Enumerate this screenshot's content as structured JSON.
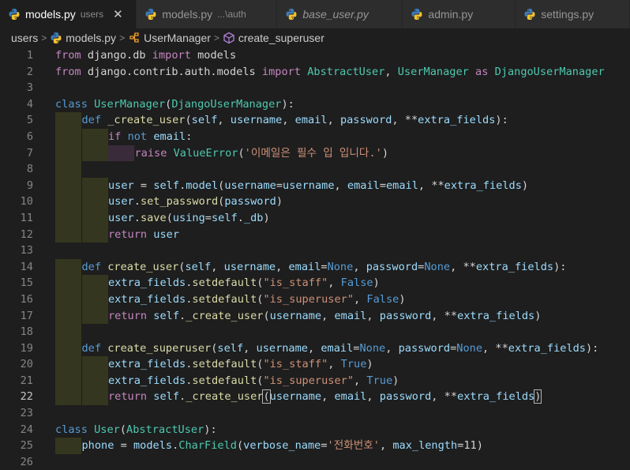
{
  "tabs": [
    {
      "name": "models.py",
      "desc": "users",
      "active": true
    },
    {
      "name": "models.py",
      "desc": "...\\auth",
      "active": false
    },
    {
      "name": "base_user.py",
      "desc": "",
      "active": false,
      "italic": true
    },
    {
      "name": "admin.py",
      "desc": "",
      "active": false
    },
    {
      "name": "settings.py",
      "desc": "",
      "active": false
    }
  ],
  "close_glyph": "✕",
  "breadcrumb": {
    "folder": "users",
    "file": "models.py",
    "class": "UserManager",
    "method": "create_superuser"
  },
  "editor": {
    "current_line": 22,
    "lines": [
      {
        "n": "1",
        "indent": 0,
        "tokens": [
          [
            "from",
            "k"
          ],
          [
            " django.db ",
            "p"
          ],
          [
            "import",
            "k"
          ],
          [
            " models",
            "p"
          ]
        ]
      },
      {
        "n": "2",
        "indent": 0,
        "tokens": [
          [
            "from",
            "k"
          ],
          [
            " django.contrib.auth.models ",
            "p"
          ],
          [
            "import",
            "k"
          ],
          [
            " ",
            "p"
          ],
          [
            "AbstractUser",
            "c"
          ],
          [
            ", ",
            "p"
          ],
          [
            "UserManager",
            "c"
          ],
          [
            " ",
            "p"
          ],
          [
            "as",
            "k"
          ],
          [
            " ",
            "p"
          ],
          [
            "DjangoUserManager",
            "c"
          ]
        ]
      },
      {
        "n": "3",
        "indent": 0,
        "tokens": []
      },
      {
        "n": "4",
        "indent": 0,
        "tokens": [
          [
            "class",
            "b"
          ],
          [
            " ",
            "p"
          ],
          [
            "UserManager",
            "c"
          ],
          [
            "(",
            "p"
          ],
          [
            "DjangoUserManager",
            "c"
          ],
          [
            "):",
            "p"
          ]
        ]
      },
      {
        "n": "5",
        "indent": 1,
        "tokens": [
          [
            "def",
            "b"
          ],
          [
            " ",
            "p"
          ],
          [
            "_create_user",
            "f"
          ],
          [
            "(",
            "p"
          ],
          [
            "self",
            "v"
          ],
          [
            ", ",
            "p"
          ],
          [
            "username",
            "v"
          ],
          [
            ", ",
            "p"
          ],
          [
            "email",
            "v"
          ],
          [
            ", ",
            "p"
          ],
          [
            "password",
            "v"
          ],
          [
            ", **",
            "p"
          ],
          [
            "extra_fields",
            "v"
          ],
          [
            "):",
            "p"
          ]
        ]
      },
      {
        "n": "6",
        "indent": 2,
        "tokens": [
          [
            "if",
            "k"
          ],
          [
            " ",
            "p"
          ],
          [
            "not",
            "b"
          ],
          [
            " ",
            "p"
          ],
          [
            "email",
            "v"
          ],
          [
            ":",
            "p"
          ]
        ]
      },
      {
        "n": "7",
        "indent": 3,
        "tokens": [
          [
            "raise",
            "k"
          ],
          [
            " ",
            "p"
          ],
          [
            "ValueError",
            "c"
          ],
          [
            "(",
            "p"
          ],
          [
            "'이메일은 필수 입 입니다.'",
            "s"
          ],
          [
            ")",
            "p"
          ]
        ]
      },
      {
        "n": "8",
        "indent": 1,
        "tokens": []
      },
      {
        "n": "9",
        "indent": 2,
        "tokens": [
          [
            "user",
            "v"
          ],
          [
            " = ",
            "p"
          ],
          [
            "self",
            "v"
          ],
          [
            ".",
            "p"
          ],
          [
            "model",
            "v"
          ],
          [
            "(",
            "p"
          ],
          [
            "username",
            "v"
          ],
          [
            "=",
            "p"
          ],
          [
            "username",
            "v"
          ],
          [
            ", ",
            "p"
          ],
          [
            "email",
            "v"
          ],
          [
            "=",
            "p"
          ],
          [
            "email",
            "v"
          ],
          [
            ", **",
            "p"
          ],
          [
            "extra_fields",
            "v"
          ],
          [
            ")",
            "p"
          ]
        ]
      },
      {
        "n": "10",
        "indent": 2,
        "tokens": [
          [
            "user",
            "v"
          ],
          [
            ".",
            "p"
          ],
          [
            "set_password",
            "f"
          ],
          [
            "(",
            "p"
          ],
          [
            "password",
            "v"
          ],
          [
            ")",
            "p"
          ]
        ]
      },
      {
        "n": "11",
        "indent": 2,
        "tokens": [
          [
            "user",
            "v"
          ],
          [
            ".",
            "p"
          ],
          [
            "save",
            "f"
          ],
          [
            "(",
            "p"
          ],
          [
            "using",
            "v"
          ],
          [
            "=",
            "p"
          ],
          [
            "self",
            "v"
          ],
          [
            ".",
            "p"
          ],
          [
            "_db",
            "v"
          ],
          [
            ")",
            "p"
          ]
        ]
      },
      {
        "n": "12",
        "indent": 2,
        "tokens": [
          [
            "return",
            "k"
          ],
          [
            " ",
            "p"
          ],
          [
            "user",
            "v"
          ]
        ]
      },
      {
        "n": "13",
        "indent": 0,
        "tokens": []
      },
      {
        "n": "14",
        "indent": 1,
        "tokens": [
          [
            "def",
            "b"
          ],
          [
            " ",
            "p"
          ],
          [
            "create_user",
            "f"
          ],
          [
            "(",
            "p"
          ],
          [
            "self",
            "v"
          ],
          [
            ", ",
            "p"
          ],
          [
            "username",
            "v"
          ],
          [
            ", ",
            "p"
          ],
          [
            "email",
            "v"
          ],
          [
            "=",
            "p"
          ],
          [
            "None",
            "b"
          ],
          [
            ", ",
            "p"
          ],
          [
            "password",
            "v"
          ],
          [
            "=",
            "p"
          ],
          [
            "None",
            "b"
          ],
          [
            ", **",
            "p"
          ],
          [
            "extra_fields",
            "v"
          ],
          [
            "):",
            "p"
          ]
        ]
      },
      {
        "n": "15",
        "indent": 2,
        "tokens": [
          [
            "extra_fields",
            "v"
          ],
          [
            ".",
            "p"
          ],
          [
            "setdefault",
            "f"
          ],
          [
            "(",
            "p"
          ],
          [
            "\"is_staff\"",
            "s"
          ],
          [
            ", ",
            "p"
          ],
          [
            "False",
            "b"
          ],
          [
            ")",
            "p"
          ]
        ]
      },
      {
        "n": "16",
        "indent": 2,
        "tokens": [
          [
            "extra_fields",
            "v"
          ],
          [
            ".",
            "p"
          ],
          [
            "setdefault",
            "f"
          ],
          [
            "(",
            "p"
          ],
          [
            "\"is_superuser\"",
            "s"
          ],
          [
            ", ",
            "p"
          ],
          [
            "False",
            "b"
          ],
          [
            ")",
            "p"
          ]
        ]
      },
      {
        "n": "17",
        "indent": 2,
        "tokens": [
          [
            "return",
            "k"
          ],
          [
            " ",
            "p"
          ],
          [
            "self",
            "v"
          ],
          [
            ".",
            "p"
          ],
          [
            "_create_user",
            "f"
          ],
          [
            "(",
            "p"
          ],
          [
            "username",
            "v"
          ],
          [
            ", ",
            "p"
          ],
          [
            "email",
            "v"
          ],
          [
            ", ",
            "p"
          ],
          [
            "password",
            "v"
          ],
          [
            ", **",
            "p"
          ],
          [
            "extra_fields",
            "v"
          ],
          [
            ")",
            "p"
          ]
        ]
      },
      {
        "n": "18",
        "indent": 1,
        "tokens": []
      },
      {
        "n": "19",
        "indent": 1,
        "tokens": [
          [
            "def",
            "b"
          ],
          [
            " ",
            "p"
          ],
          [
            "create_superuser",
            "f"
          ],
          [
            "(",
            "p"
          ],
          [
            "self",
            "v"
          ],
          [
            ", ",
            "p"
          ],
          [
            "username",
            "v"
          ],
          [
            ", ",
            "p"
          ],
          [
            "email",
            "v"
          ],
          [
            "=",
            "p"
          ],
          [
            "None",
            "b"
          ],
          [
            ", ",
            "p"
          ],
          [
            "password",
            "v"
          ],
          [
            "=",
            "p"
          ],
          [
            "None",
            "b"
          ],
          [
            ", **",
            "p"
          ],
          [
            "extra_fields",
            "v"
          ],
          [
            "):",
            "p"
          ]
        ]
      },
      {
        "n": "20",
        "indent": 2,
        "tokens": [
          [
            "extra_fields",
            "v"
          ],
          [
            ".",
            "p"
          ],
          [
            "setdefault",
            "f"
          ],
          [
            "(",
            "p"
          ],
          [
            "\"is_staff\"",
            "s"
          ],
          [
            ", ",
            "p"
          ],
          [
            "True",
            "b"
          ],
          [
            ")",
            "p"
          ]
        ]
      },
      {
        "n": "21",
        "indent": 2,
        "tokens": [
          [
            "extra_fields",
            "v"
          ],
          [
            ".",
            "p"
          ],
          [
            "setdefault",
            "f"
          ],
          [
            "(",
            "p"
          ],
          [
            "\"is_superuser\"",
            "s"
          ],
          [
            ", ",
            "p"
          ],
          [
            "True",
            "b"
          ],
          [
            ")",
            "p"
          ]
        ]
      },
      {
        "n": "22",
        "indent": 2,
        "tokens": [
          [
            "return",
            "k"
          ],
          [
            " ",
            "p"
          ],
          [
            "self",
            "v"
          ],
          [
            ".",
            "p"
          ],
          [
            "_create_user",
            "f"
          ],
          [
            "(",
            "bracket"
          ],
          [
            "username",
            "v"
          ],
          [
            ", ",
            "p"
          ],
          [
            "email",
            "v"
          ],
          [
            ", ",
            "p"
          ],
          [
            "password",
            "v"
          ],
          [
            ", **",
            "p"
          ],
          [
            "extra_fields",
            "v"
          ],
          [
            ")",
            "bracket"
          ]
        ]
      },
      {
        "n": "23",
        "indent": 0,
        "tokens": []
      },
      {
        "n": "24",
        "indent": 0,
        "tokens": [
          [
            "class",
            "b"
          ],
          [
            " ",
            "p"
          ],
          [
            "User",
            "c"
          ],
          [
            "(",
            "p"
          ],
          [
            "AbstractUser",
            "c"
          ],
          [
            "):",
            "p"
          ]
        ]
      },
      {
        "n": "25",
        "indent": 1,
        "tokens": [
          [
            "phone",
            "v"
          ],
          [
            " = ",
            "p"
          ],
          [
            "models",
            "v"
          ],
          [
            ".",
            "p"
          ],
          [
            "CharField",
            "c"
          ],
          [
            "(",
            "p"
          ],
          [
            "verbose_name",
            "v"
          ],
          [
            "=",
            "p"
          ],
          [
            "'전화번호'",
            "s"
          ],
          [
            ", ",
            "p"
          ],
          [
            "max_length",
            "v"
          ],
          [
            "=",
            "p"
          ],
          [
            "11",
            "p"
          ],
          [
            ")",
            "p"
          ]
        ]
      },
      {
        "n": "26",
        "indent": 0,
        "tokens": []
      }
    ]
  }
}
